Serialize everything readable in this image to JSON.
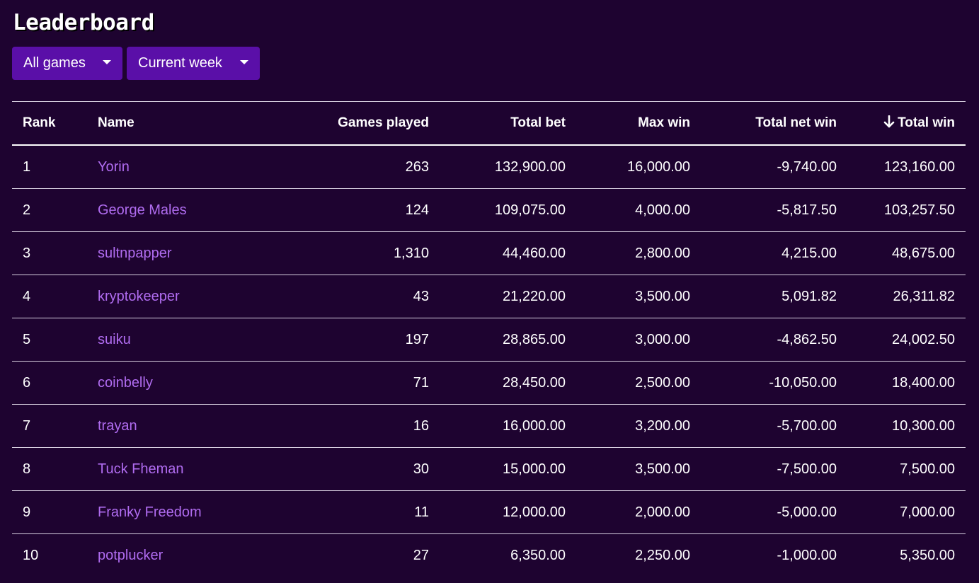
{
  "page": {
    "title": "Leaderboard"
  },
  "filters": {
    "game": "All games",
    "period": "Current week"
  },
  "table": {
    "columns": {
      "rank": "Rank",
      "name": "Name",
      "games_played": "Games played",
      "total_bet": "Total bet",
      "max_win": "Max win",
      "total_net_win": "Total net win",
      "total_win": "Total win"
    },
    "sort_arrow": "🡓",
    "rows": [
      {
        "rank": "1",
        "name": "Yorin",
        "games_played": "263",
        "total_bet": "132,900.00",
        "max_win": "16,000.00",
        "total_net_win": "-9,740.00",
        "total_win": "123,160.00"
      },
      {
        "rank": "2",
        "name": "George Males",
        "games_played": "124",
        "total_bet": "109,075.00",
        "max_win": "4,000.00",
        "total_net_win": "-5,817.50",
        "total_win": "103,257.50"
      },
      {
        "rank": "3",
        "name": "sultnpapper",
        "games_played": "1,310",
        "total_bet": "44,460.00",
        "max_win": "2,800.00",
        "total_net_win": "4,215.00",
        "total_win": "48,675.00"
      },
      {
        "rank": "4",
        "name": "kryptokeeper",
        "games_played": "43",
        "total_bet": "21,220.00",
        "max_win": "3,500.00",
        "total_net_win": "5,091.82",
        "total_win": "26,311.82"
      },
      {
        "rank": "5",
        "name": "suiku",
        "games_played": "197",
        "total_bet": "28,865.00",
        "max_win": "3,000.00",
        "total_net_win": "-4,862.50",
        "total_win": "24,002.50"
      },
      {
        "rank": "6",
        "name": "coinbelly",
        "games_played": "71",
        "total_bet": "28,450.00",
        "max_win": "2,500.00",
        "total_net_win": "-10,050.00",
        "total_win": "18,400.00"
      },
      {
        "rank": "7",
        "name": "trayan",
        "games_played": "16",
        "total_bet": "16,000.00",
        "max_win": "3,200.00",
        "total_net_win": "-5,700.00",
        "total_win": "10,300.00"
      },
      {
        "rank": "8",
        "name": "Tuck Fheman",
        "games_played": "30",
        "total_bet": "15,000.00",
        "max_win": "3,500.00",
        "total_net_win": "-7,500.00",
        "total_win": "7,500.00"
      },
      {
        "rank": "9",
        "name": "Franky Freedom",
        "games_played": "11",
        "total_bet": "12,000.00",
        "max_win": "2,000.00",
        "total_net_win": "-5,000.00",
        "total_win": "7,000.00"
      },
      {
        "rank": "10",
        "name": "potplucker",
        "games_played": "27",
        "total_bet": "6,350.00",
        "max_win": "2,250.00",
        "total_net_win": "-1,000.00",
        "total_win": "5,350.00"
      }
    ]
  },
  "colors": {
    "background": "#1e0330",
    "dropdown": "#5a0fa8",
    "link": "#b06cf0"
  }
}
